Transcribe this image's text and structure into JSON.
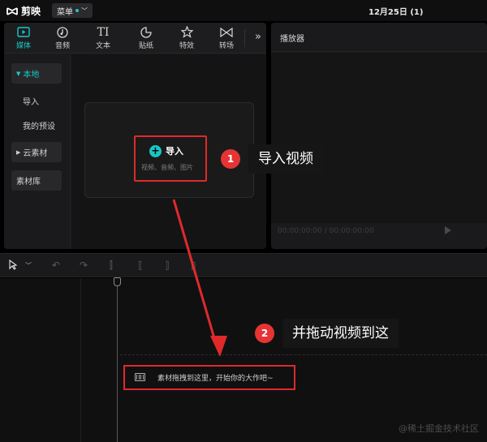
{
  "topbar": {
    "app_name": "剪映",
    "menu_label": "菜单",
    "title": "12月25日 (1)"
  },
  "media": {
    "tabs": [
      {
        "label": "媒体",
        "icon": "media-icon"
      },
      {
        "label": "音频",
        "icon": "audio-icon"
      },
      {
        "label": "文本",
        "icon": "text-icon"
      },
      {
        "label": "贴纸",
        "icon": "sticker-icon"
      },
      {
        "label": "特效",
        "icon": "effects-icon"
      },
      {
        "label": "转场",
        "icon": "transition-icon"
      }
    ],
    "more_label": "»",
    "sidebar": [
      {
        "label": "本地",
        "arrow": "▼"
      },
      {
        "label": "导入"
      },
      {
        "label": "我的预设"
      },
      {
        "label": "云素材",
        "arrow": "▶"
      },
      {
        "label": "素材库"
      }
    ],
    "import_label": "导入",
    "import_sub": "视频、音频、图片"
  },
  "player": {
    "title": "播放器",
    "timecode": "00:00:00:00 / 00:00:00:00"
  },
  "timeline": {
    "drop_hint": "素材拖拽到这里，开始你的大作吧~"
  },
  "annotations": [
    {
      "number": "1",
      "text": "导入视频"
    },
    {
      "number": "2",
      "text": "并拖动视频到这"
    }
  ],
  "colors": {
    "accent": "#19c8c8",
    "highlight": "#e02a2a",
    "badge": "#e63434"
  },
  "watermark": "@稀土掘金技术社区"
}
